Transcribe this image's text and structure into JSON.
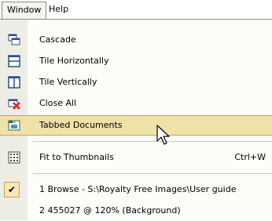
{
  "menubar": {
    "window_label": "Window",
    "help_label": "Help"
  },
  "menu": {
    "items": [
      {
        "label": "Cascade",
        "icon": "cascade-icon"
      },
      {
        "label": "Tile Horizontally",
        "icon": "tile-horizontal-icon"
      },
      {
        "label": "Tile Vertically",
        "icon": "tile-vertical-icon"
      },
      {
        "label": "Close All",
        "icon": "close-all-icon"
      },
      {
        "label": "Tabbed Documents",
        "icon": "tabbed-documents-icon"
      },
      {
        "label": "Fit to Thumbnails",
        "icon": "thumbnails-icon",
        "shortcut": "Ctrl+W"
      },
      {
        "label": "1 Browse - S:\\Royalty Free Images\\User guide",
        "checked": true
      },
      {
        "label": "2 455027 @ 120% (Background)"
      }
    ]
  },
  "colors": {
    "highlight": "#efe2a6",
    "icon_column": "#eeede5",
    "check_bg": "#f6e9b7"
  }
}
